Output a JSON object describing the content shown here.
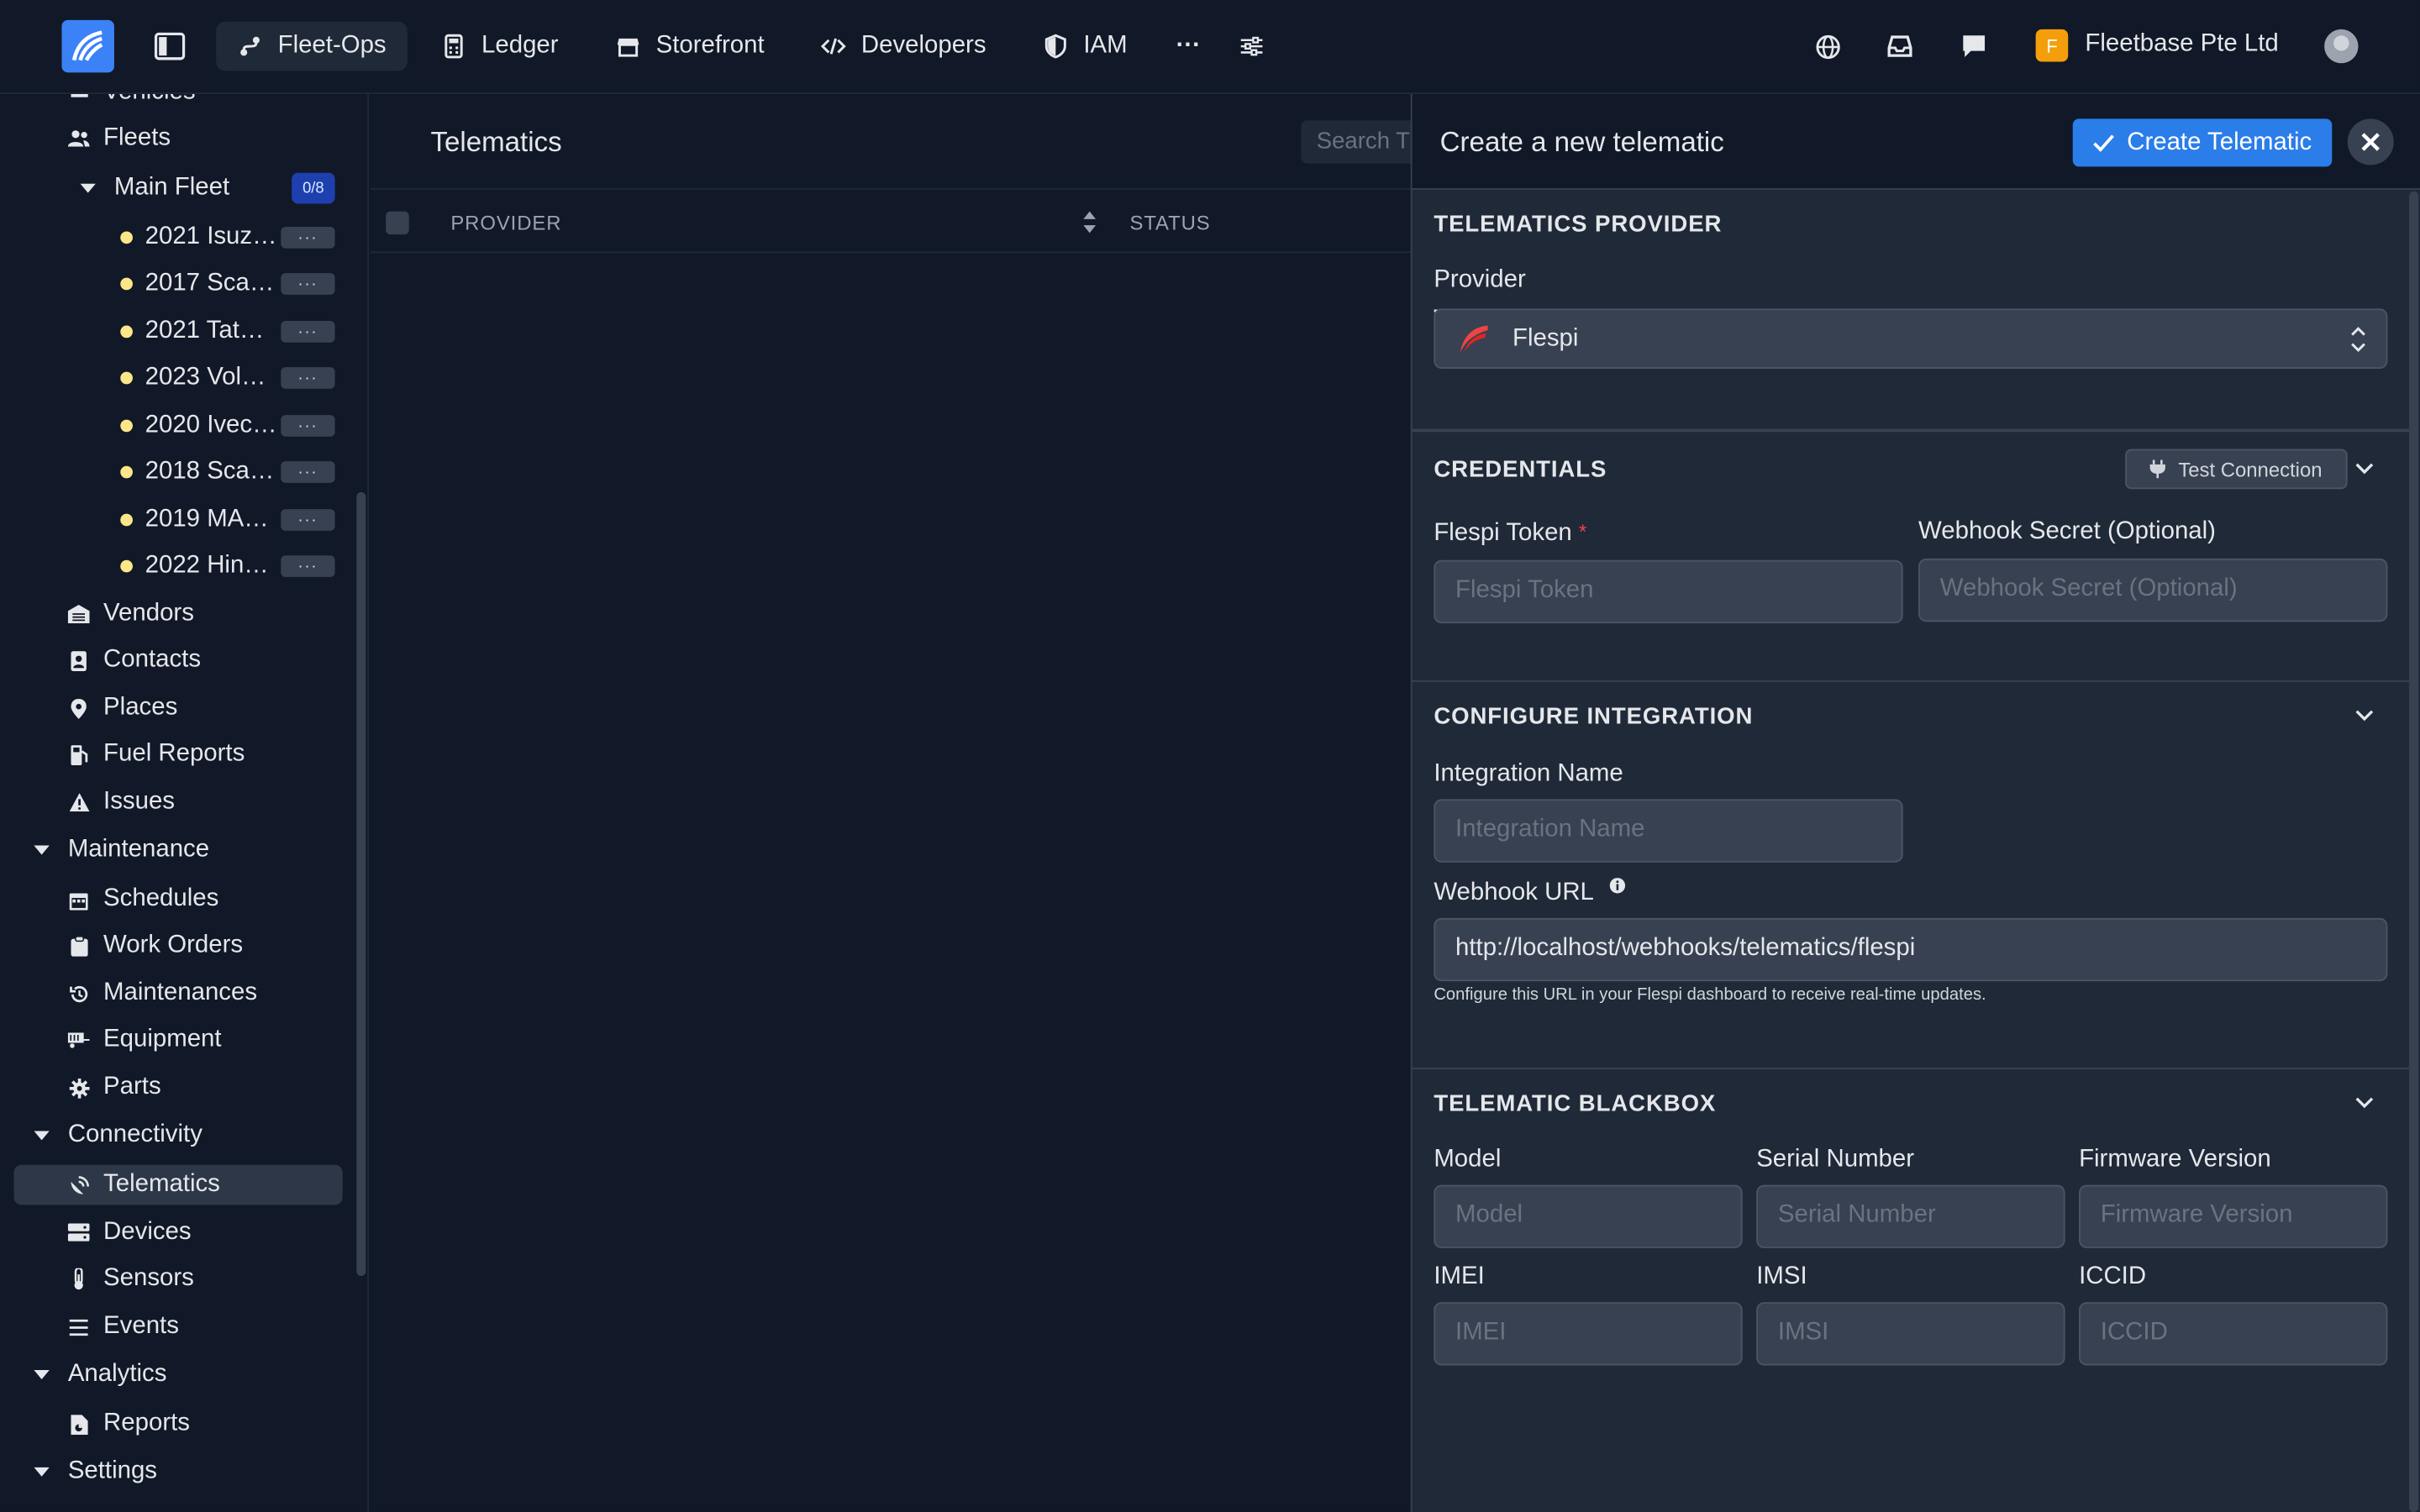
{
  "topbar": {
    "nav": [
      {
        "label": "Fleet-Ops",
        "icon": "route-icon",
        "active": true
      },
      {
        "label": "Ledger",
        "icon": "calculator-icon",
        "active": false
      },
      {
        "label": "Storefront",
        "icon": "store-icon",
        "active": false
      },
      {
        "label": "Developers",
        "icon": "code-icon",
        "active": false
      },
      {
        "label": "IAM",
        "icon": "shield-icon",
        "active": false
      }
    ],
    "more": "···",
    "org": {
      "badge": "F",
      "name": "Fleetbase Pte Ltd"
    }
  },
  "sidebar": {
    "top_partial": "Vehicles",
    "fleets": "Fleets",
    "main_fleet": "Main Fleet",
    "main_fleet_count": "0/8",
    "vehicles": [
      "2021 Isuz…",
      "2017 Sca…",
      "2021 Tat…",
      "2023 Vol…",
      "2020 Ivec…",
      "2018 Sca…",
      "2019 MA…",
      "2022 Hin…"
    ],
    "more_label": "···",
    "items_a": [
      "Vendors",
      "Contacts",
      "Places",
      "Fuel Reports",
      "Issues"
    ],
    "maintenance": "Maintenance",
    "items_b": [
      "Schedules",
      "Work Orders",
      "Maintenances",
      "Equipment",
      "Parts"
    ],
    "connectivity": "Connectivity",
    "items_c": [
      "Telematics",
      "Devices",
      "Sensors",
      "Events"
    ],
    "analytics": "Analytics",
    "reports": "Reports",
    "settings": "Settings"
  },
  "main": {
    "title": "Telematics",
    "search_placeholder": "Search T",
    "columns": [
      "PROVIDER",
      "STATUS"
    ]
  },
  "drawer": {
    "title": "Create a new telematic",
    "create_button": "Create Telematic",
    "provider_section": {
      "title": "TELEMATICS PROVIDER",
      "provider_label": "Provider",
      "provider_value": "Flespi"
    },
    "credentials_section": {
      "title": "CREDENTIALS",
      "test_button": "Test Connection",
      "token_label": "Flespi Token",
      "token_required": "*",
      "token_placeholder": "Flespi Token",
      "secret_label": "Webhook Secret (Optional)",
      "secret_placeholder": "Webhook Secret (Optional)"
    },
    "integration_section": {
      "title": "CONFIGURE INTEGRATION",
      "name_label": "Integration Name",
      "name_placeholder": "Integration Name",
      "webhook_label": "Webhook URL",
      "webhook_value": "http://localhost/webhooks/telematics/flespi",
      "help_text": "Configure this URL in your Flespi dashboard to receive real-time updates."
    },
    "blackbox_section": {
      "title": "TELEMATIC BLACKBOX",
      "fields": [
        {
          "label": "Model",
          "placeholder": "Model"
        },
        {
          "label": "Serial Number",
          "placeholder": "Serial Number"
        },
        {
          "label": "Firmware Version",
          "placeholder": "Firmware Version"
        },
        {
          "label": "IMEI",
          "placeholder": "IMEI"
        },
        {
          "label": "IMSI",
          "placeholder": "IMSI"
        },
        {
          "label": "ICCID",
          "placeholder": "ICCID"
        }
      ]
    }
  },
  "colors": {
    "background": "#111827",
    "panel": "#1f2937",
    "primary": "#2b7de9",
    "org_badge": "#f59e0b",
    "vehicle_dot": "#fde68a",
    "required": "#ef4444"
  }
}
